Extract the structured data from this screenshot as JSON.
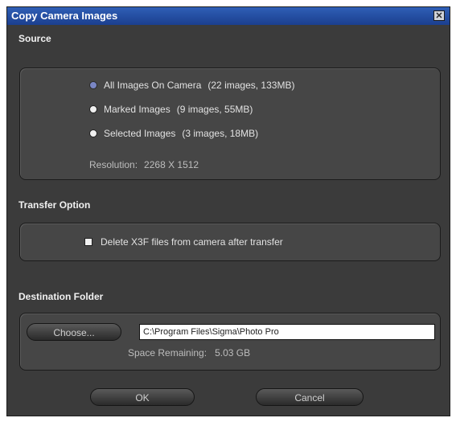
{
  "window": {
    "title": "Copy Camera Images"
  },
  "source": {
    "heading": "Source",
    "options": [
      {
        "label": "All Images On Camera",
        "detail": "(22 images, 133MB)",
        "selected": true
      },
      {
        "label": "Marked Images",
        "detail": "(9 images, 55MB)",
        "selected": false
      },
      {
        "label": "Selected Images",
        "detail": "(3 images, 18MB)",
        "selected": false
      }
    ],
    "resolution_label": "Resolution:",
    "resolution_value": "2268 X 1512"
  },
  "transfer": {
    "heading": "Transfer Option",
    "delete_label": "Delete X3F files from camera after transfer",
    "delete_checked": false
  },
  "destination": {
    "heading": "Destination Folder",
    "choose_label": "Choose...",
    "path_value": "C:\\Program Files\\Sigma\\Photo Pro",
    "space_label": "Space Remaining:",
    "space_value": "5.03 GB"
  },
  "buttons": {
    "ok": "OK",
    "cancel": "Cancel"
  },
  "colors": {
    "titlebar": "#1b3f8f",
    "dialog_background": "#3b3b3b",
    "group_background": "#464646",
    "selected_radio": "#7a86c4"
  }
}
